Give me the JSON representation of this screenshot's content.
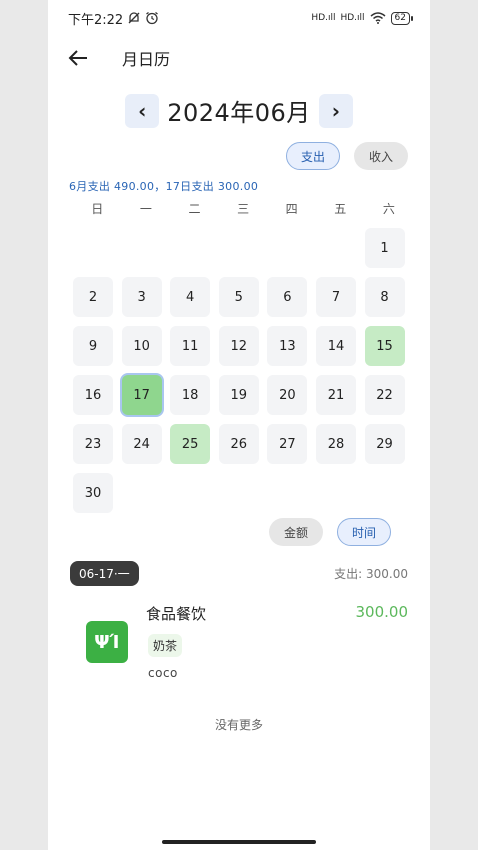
{
  "status": {
    "time": "下午2:22",
    "signal1": "HD.ıll",
    "signal2": "HD.ıll",
    "battery": "62"
  },
  "topbar": {
    "title": "月日历"
  },
  "month": {
    "label": "2024年06月",
    "prev": "‹",
    "next": "›"
  },
  "type_toggle": {
    "expense": "支出",
    "income": "收入"
  },
  "summary": "6月支出  490.00，17日支出  300.00",
  "weekdays": [
    "日",
    "一",
    "二",
    "三",
    "四",
    "五",
    "六"
  ],
  "days": [
    {
      "d": "",
      "s": "empty"
    },
    {
      "d": "",
      "s": "empty"
    },
    {
      "d": "",
      "s": "empty"
    },
    {
      "d": "",
      "s": "empty"
    },
    {
      "d": "",
      "s": "empty"
    },
    {
      "d": "",
      "s": "empty"
    },
    {
      "d": "1",
      "s": ""
    },
    {
      "d": "2",
      "s": ""
    },
    {
      "d": "3",
      "s": ""
    },
    {
      "d": "4",
      "s": ""
    },
    {
      "d": "5",
      "s": ""
    },
    {
      "d": "6",
      "s": ""
    },
    {
      "d": "7",
      "s": ""
    },
    {
      "d": "8",
      "s": ""
    },
    {
      "d": "9",
      "s": ""
    },
    {
      "d": "10",
      "s": ""
    },
    {
      "d": "11",
      "s": ""
    },
    {
      "d": "12",
      "s": ""
    },
    {
      "d": "13",
      "s": ""
    },
    {
      "d": "14",
      "s": ""
    },
    {
      "d": "15",
      "s": "green"
    },
    {
      "d": "16",
      "s": ""
    },
    {
      "d": "17",
      "s": "selected"
    },
    {
      "d": "18",
      "s": ""
    },
    {
      "d": "19",
      "s": ""
    },
    {
      "d": "20",
      "s": ""
    },
    {
      "d": "21",
      "s": ""
    },
    {
      "d": "22",
      "s": ""
    },
    {
      "d": "23",
      "s": ""
    },
    {
      "d": "24",
      "s": ""
    },
    {
      "d": "25",
      "s": "green"
    },
    {
      "d": "26",
      "s": ""
    },
    {
      "d": "27",
      "s": ""
    },
    {
      "d": "28",
      "s": ""
    },
    {
      "d": "29",
      "s": ""
    },
    {
      "d": "30",
      "s": ""
    }
  ],
  "sort_toggle": {
    "amount": "金额",
    "time": "时间"
  },
  "day_group": {
    "date": "06-17·一",
    "total": "支出: 300.00"
  },
  "entry": {
    "category": "食品餐饮",
    "icon": "fork-knife-icon",
    "icon_glyph": "ΨΊ",
    "tag": "奶茶",
    "note": "coco",
    "amount": "300.00"
  },
  "footer": {
    "no_more": "没有更多"
  },
  "colors": {
    "accent": "#2a65b5",
    "green": "#3cb044",
    "amount_green": "#5cb85c"
  }
}
